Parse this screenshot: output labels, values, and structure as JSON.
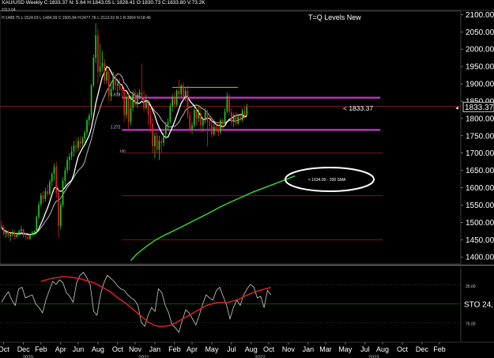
{
  "header": {
    "line1": "XAU/USD Weekly C:1833.37 N: 5.64 H:1843.05 L:1828.41 O:1830.73 C:1833.80 V:73.2K",
    "line2": "2113.04",
    "line3": "H:1488.75 L:1524.03 L:1484.39 C:1505.84 H:2477.7K L:2113.03 N:1 R:3964 N:18.46"
  },
  "annotation_title": "T=Q Levels New",
  "callout_price": "< 1833.37",
  "ellipse_label": "< 1634.00 - 200 SMA",
  "colors": {
    "background": "#000000",
    "up_candle": "#22cc22",
    "down_candle": "#e02020",
    "sma200": "#33dd33",
    "fast_ma": "#ffffff",
    "slow_ma": "#bbbbbb",
    "level_magenta": "#cc33cc",
    "level_red": "#8b1a1a",
    "stoch_k": "#cccccc",
    "stoch_d": "#dd2222"
  },
  "chart_data": {
    "type": "candlestick",
    "title": "T=Q Levels New",
    "price_axis": {
      "ticks": [
        2100,
        2050,
        2000,
        1950,
        1900,
        1850,
        1800,
        1750,
        1700,
        1650,
        1600,
        1550,
        1500,
        1450,
        1400
      ],
      "tick_labels": [
        "2100.00",
        "2050.00",
        "2000.00",
        "1950.00",
        "1900.00",
        "1850.00",
        "1800.00",
        "1750.00",
        "1700.00",
        "1650.00",
        "1600.00",
        "1550.00",
        "1500.00",
        "1450.00",
        "1400.00"
      ],
      "ylim": [
        1380,
        2110
      ],
      "current": 1833.37,
      "current_label": "1833.37"
    },
    "time_axis": {
      "month_labels": [
        "Oct",
        "Dec",
        "Feb",
        "Apr",
        "Jun",
        "Aug",
        "Oct",
        "Nov",
        "Jan",
        "Feb",
        "Apr",
        "May",
        "Jul",
        "Aug",
        "Oct",
        "Nov",
        "Jan",
        "Mar",
        "May",
        "Jul",
        "Aug",
        "Oct",
        "Dec",
        "Feb"
      ],
      "year_labels": [
        "2020",
        "2021",
        "2022",
        "2023"
      ],
      "week_range": [
        0,
        179
      ],
      "month_weeks": [
        1,
        10,
        18,
        27,
        35,
        44,
        53,
        61,
        70,
        79,
        87,
        96,
        105,
        114,
        122,
        131,
        140,
        148,
        157,
        166,
        174,
        183,
        192,
        200
      ],
      "year_weeks": [
        12,
        65,
        118,
        170
      ]
    },
    "levels": [
      {
        "label": "1.618",
        "value": 1860,
        "color": "#cc33cc"
      },
      {
        "label": "1.272",
        "value": 1767,
        "color": "#cc33cc"
      },
      {
        "label": "",
        "value": 1890,
        "color": "#cccc33"
      },
      {
        "label": "",
        "value": 1835,
        "color": "#8b1a1a"
      },
      {
        "label": "",
        "value": 1700,
        "color": "#8b1a1a"
      },
      {
        "label": "",
        "value": 1577,
        "color": "#8b1a1a"
      },
      {
        "label": "",
        "value": 1450,
        "color": "#8b1a1a"
      }
    ],
    "candles": [
      {
        "o": 1492,
        "h": 1505,
        "l": 1480,
        "c": 1486
      },
      {
        "o": 1486,
        "h": 1492,
        "l": 1460,
        "c": 1466
      },
      {
        "o": 1466,
        "h": 1480,
        "l": 1455,
        "c": 1472
      },
      {
        "o": 1472,
        "h": 1478,
        "l": 1455,
        "c": 1460
      },
      {
        "o": 1460,
        "h": 1470,
        "l": 1445,
        "c": 1465
      },
      {
        "o": 1465,
        "h": 1480,
        "l": 1460,
        "c": 1470
      },
      {
        "o": 1470,
        "h": 1478,
        "l": 1450,
        "c": 1458
      },
      {
        "o": 1458,
        "h": 1470,
        "l": 1455,
        "c": 1465
      },
      {
        "o": 1465,
        "h": 1480,
        "l": 1460,
        "c": 1475
      },
      {
        "o": 1475,
        "h": 1490,
        "l": 1465,
        "c": 1480
      },
      {
        "o": 1480,
        "h": 1482,
        "l": 1455,
        "c": 1462
      },
      {
        "o": 1462,
        "h": 1470,
        "l": 1450,
        "c": 1458
      },
      {
        "o": 1458,
        "h": 1462,
        "l": 1448,
        "c": 1452
      },
      {
        "o": 1452,
        "h": 1468,
        "l": 1450,
        "c": 1465
      },
      {
        "o": 1465,
        "h": 1476,
        "l": 1460,
        "c": 1472
      },
      {
        "o": 1472,
        "h": 1478,
        "l": 1464,
        "c": 1475
      },
      {
        "o": 1475,
        "h": 1520,
        "l": 1470,
        "c": 1515
      },
      {
        "o": 1515,
        "h": 1560,
        "l": 1510,
        "c": 1552
      },
      {
        "o": 1552,
        "h": 1585,
        "l": 1545,
        "c": 1578
      },
      {
        "o": 1578,
        "h": 1590,
        "l": 1555,
        "c": 1568
      },
      {
        "o": 1568,
        "h": 1600,
        "l": 1560,
        "c": 1590
      },
      {
        "o": 1590,
        "h": 1610,
        "l": 1575,
        "c": 1582
      },
      {
        "o": 1582,
        "h": 1625,
        "l": 1578,
        "c": 1618
      },
      {
        "o": 1618,
        "h": 1645,
        "l": 1605,
        "c": 1640
      },
      {
        "o": 1640,
        "h": 1670,
        "l": 1620,
        "c": 1660
      },
      {
        "o": 1660,
        "h": 1675,
        "l": 1570,
        "c": 1585
      },
      {
        "o": 1585,
        "h": 1600,
        "l": 1455,
        "c": 1490
      },
      {
        "o": 1490,
        "h": 1560,
        "l": 1480,
        "c": 1550
      },
      {
        "o": 1550,
        "h": 1630,
        "l": 1545,
        "c": 1620
      },
      {
        "o": 1620,
        "h": 1660,
        "l": 1605,
        "c": 1650
      },
      {
        "o": 1650,
        "h": 1690,
        "l": 1640,
        "c": 1680
      },
      {
        "o": 1680,
        "h": 1700,
        "l": 1650,
        "c": 1690
      },
      {
        "o": 1690,
        "h": 1720,
        "l": 1680,
        "c": 1705
      },
      {
        "o": 1705,
        "h": 1735,
        "l": 1690,
        "c": 1722
      },
      {
        "o": 1722,
        "h": 1740,
        "l": 1700,
        "c": 1715
      },
      {
        "o": 1715,
        "h": 1745,
        "l": 1705,
        "c": 1735
      },
      {
        "o": 1735,
        "h": 1750,
        "l": 1715,
        "c": 1728
      },
      {
        "o": 1728,
        "h": 1748,
        "l": 1720,
        "c": 1742
      },
      {
        "o": 1742,
        "h": 1765,
        "l": 1730,
        "c": 1760
      },
      {
        "o": 1760,
        "h": 1800,
        "l": 1750,
        "c": 1795
      },
      {
        "o": 1795,
        "h": 1815,
        "l": 1780,
        "c": 1808
      },
      {
        "o": 1808,
        "h": 1900,
        "l": 1800,
        "c": 1895
      },
      {
        "o": 1895,
        "h": 1985,
        "l": 1890,
        "c": 1975
      },
      {
        "o": 1975,
        "h": 2075,
        "l": 1960,
        "c": 2040
      },
      {
        "o": 2040,
        "h": 2060,
        "l": 1900,
        "c": 1935
      },
      {
        "o": 1935,
        "h": 2015,
        "l": 1920,
        "c": 1950
      },
      {
        "o": 1950,
        "h": 1995,
        "l": 1935,
        "c": 1960
      },
      {
        "o": 1960,
        "h": 1972,
        "l": 1900,
        "c": 1910
      },
      {
        "o": 1910,
        "h": 1950,
        "l": 1900,
        "c": 1935
      },
      {
        "o": 1935,
        "h": 1945,
        "l": 1850,
        "c": 1865
      },
      {
        "o": 1865,
        "h": 1905,
        "l": 1850,
        "c": 1885
      },
      {
        "o": 1885,
        "h": 1935,
        "l": 1880,
        "c": 1925
      },
      {
        "o": 1925,
        "h": 1930,
        "l": 1880,
        "c": 1895
      },
      {
        "o": 1895,
        "h": 1910,
        "l": 1870,
        "c": 1900
      },
      {
        "o": 1900,
        "h": 1915,
        "l": 1880,
        "c": 1885
      },
      {
        "o": 1885,
        "h": 1895,
        "l": 1860,
        "c": 1880
      },
      {
        "o": 1880,
        "h": 1890,
        "l": 1790,
        "c": 1810
      },
      {
        "o": 1810,
        "h": 1870,
        "l": 1800,
        "c": 1862
      },
      {
        "o": 1862,
        "h": 1875,
        "l": 1770,
        "c": 1790
      },
      {
        "o": 1790,
        "h": 1865,
        "l": 1780,
        "c": 1830
      },
      {
        "o": 1830,
        "h": 1880,
        "l": 1820,
        "c": 1875
      },
      {
        "o": 1875,
        "h": 1885,
        "l": 1835,
        "c": 1840
      },
      {
        "o": 1840,
        "h": 1875,
        "l": 1830,
        "c": 1868
      },
      {
        "o": 1868,
        "h": 1885,
        "l": 1855,
        "c": 1875
      },
      {
        "o": 1875,
        "h": 1958,
        "l": 1850,
        "c": 1855
      },
      {
        "o": 1855,
        "h": 1880,
        "l": 1820,
        "c": 1830
      },
      {
        "o": 1830,
        "h": 1870,
        "l": 1825,
        "c": 1845
      },
      {
        "o": 1845,
        "h": 1850,
        "l": 1780,
        "c": 1810
      },
      {
        "o": 1810,
        "h": 1830,
        "l": 1760,
        "c": 1785
      },
      {
        "o": 1785,
        "h": 1800,
        "l": 1700,
        "c": 1720
      },
      {
        "o": 1720,
        "h": 1760,
        "l": 1685,
        "c": 1750
      },
      {
        "o": 1750,
        "h": 1760,
        "l": 1700,
        "c": 1710
      },
      {
        "o": 1710,
        "h": 1750,
        "l": 1680,
        "c": 1735
      },
      {
        "o": 1735,
        "h": 1745,
        "l": 1700,
        "c": 1730
      },
      {
        "o": 1730,
        "h": 1760,
        "l": 1720,
        "c": 1755
      },
      {
        "o": 1755,
        "h": 1790,
        "l": 1740,
        "c": 1780
      },
      {
        "o": 1780,
        "h": 1800,
        "l": 1765,
        "c": 1790
      },
      {
        "o": 1790,
        "h": 1845,
        "l": 1785,
        "c": 1835
      },
      {
        "o": 1835,
        "h": 1870,
        "l": 1820,
        "c": 1860
      },
      {
        "o": 1860,
        "h": 1875,
        "l": 1830,
        "c": 1840
      },
      {
        "o": 1840,
        "h": 1885,
        "l": 1835,
        "c": 1880
      },
      {
        "o": 1880,
        "h": 1912,
        "l": 1860,
        "c": 1870
      },
      {
        "o": 1870,
        "h": 1900,
        "l": 1860,
        "c": 1895
      },
      {
        "o": 1895,
        "h": 1905,
        "l": 1855,
        "c": 1860
      },
      {
        "o": 1860,
        "h": 1890,
        "l": 1850,
        "c": 1880
      },
      {
        "o": 1880,
        "h": 1895,
        "l": 1800,
        "c": 1810
      },
      {
        "o": 1810,
        "h": 1820,
        "l": 1760,
        "c": 1770
      },
      {
        "o": 1770,
        "h": 1790,
        "l": 1755,
        "c": 1780
      },
      {
        "o": 1780,
        "h": 1835,
        "l": 1775,
        "c": 1825
      },
      {
        "o": 1825,
        "h": 1830,
        "l": 1780,
        "c": 1800
      },
      {
        "o": 1800,
        "h": 1835,
        "l": 1790,
        "c": 1815
      },
      {
        "o": 1815,
        "h": 1830,
        "l": 1760,
        "c": 1780
      },
      {
        "o": 1780,
        "h": 1800,
        "l": 1760,
        "c": 1795
      },
      {
        "o": 1795,
        "h": 1830,
        "l": 1785,
        "c": 1820
      },
      {
        "o": 1820,
        "h": 1825,
        "l": 1720,
        "c": 1790
      },
      {
        "o": 1790,
        "h": 1810,
        "l": 1770,
        "c": 1780
      },
      {
        "o": 1780,
        "h": 1795,
        "l": 1745,
        "c": 1755
      },
      {
        "o": 1755,
        "h": 1785,
        "l": 1750,
        "c": 1775
      },
      {
        "o": 1775,
        "h": 1790,
        "l": 1760,
        "c": 1765
      },
      {
        "o": 1765,
        "h": 1780,
        "l": 1750,
        "c": 1760
      },
      {
        "o": 1760,
        "h": 1800,
        "l": 1755,
        "c": 1795
      },
      {
        "o": 1795,
        "h": 1800,
        "l": 1770,
        "c": 1785
      },
      {
        "o": 1785,
        "h": 1830,
        "l": 1780,
        "c": 1820
      },
      {
        "o": 1820,
        "h": 1875,
        "l": 1815,
        "c": 1865
      },
      {
        "o": 1865,
        "h": 1870,
        "l": 1810,
        "c": 1818
      },
      {
        "o": 1818,
        "h": 1830,
        "l": 1780,
        "c": 1790
      },
      {
        "o": 1790,
        "h": 1815,
        "l": 1775,
        "c": 1810
      },
      {
        "o": 1810,
        "h": 1820,
        "l": 1780,
        "c": 1785
      },
      {
        "o": 1785,
        "h": 1810,
        "l": 1780,
        "c": 1805
      },
      {
        "o": 1805,
        "h": 1815,
        "l": 1790,
        "c": 1795
      },
      {
        "o": 1795,
        "h": 1830,
        "l": 1790,
        "c": 1822
      },
      {
        "o": 1822,
        "h": 1835,
        "l": 1800,
        "c": 1810
      },
      {
        "o": 1810,
        "h": 1843,
        "l": 1805,
        "c": 1833
      }
    ],
    "series": [
      {
        "name": "",
        "kind": "price_overlay",
        "values": []
      }
    ],
    "sma200": [
      [
        59,
        1390
      ],
      [
        62,
        1410
      ],
      [
        66,
        1430
      ],
      [
        70,
        1448
      ],
      [
        75,
        1465
      ],
      [
        80,
        1480
      ],
      [
        85,
        1496
      ],
      [
        90,
        1512
      ],
      [
        95,
        1528
      ],
      [
        100,
        1545
      ],
      [
        105,
        1560
      ],
      [
        110,
        1574
      ],
      [
        115,
        1588
      ],
      [
        120,
        1600
      ],
      [
        125,
        1612
      ],
      [
        130,
        1624
      ],
      [
        134,
        1634
      ]
    ],
    "stoch_panel": {
      "label": "STO 24,",
      "tick_labels": [
        "25.00",
        "75.00"
      ],
      "ylim": [
        0,
        100
      ],
      "k": [
        52,
        60,
        66,
        55,
        48,
        70,
        72,
        58,
        60,
        62,
        50,
        45,
        38,
        55,
        68,
        80,
        76,
        82,
        78,
        65,
        60,
        52,
        78,
        88,
        92,
        85,
        75,
        40,
        35,
        62,
        78,
        88,
        84,
        80,
        74,
        70,
        68,
        62,
        58,
        55,
        48,
        25,
        20,
        35,
        45,
        40,
        70,
        65,
        48,
        38,
        22,
        18,
        12,
        28,
        42,
        38,
        30,
        22,
        35,
        50,
        62,
        58,
        55,
        68,
        72,
        60,
        48,
        30,
        45,
        55,
        48,
        62,
        70,
        76,
        72,
        58,
        60,
        45,
        68,
        62
      ],
      "d": [
        80,
        82,
        84,
        85,
        86,
        86,
        85,
        84,
        82,
        80,
        78,
        74,
        70,
        66,
        60,
        55,
        50,
        44,
        38,
        32,
        26,
        22,
        20,
        20,
        21,
        24,
        28,
        32,
        36,
        40,
        44,
        48,
        50,
        52,
        52,
        52,
        54,
        56,
        60,
        63,
        66,
        68,
        70,
        72
      ]
    }
  }
}
